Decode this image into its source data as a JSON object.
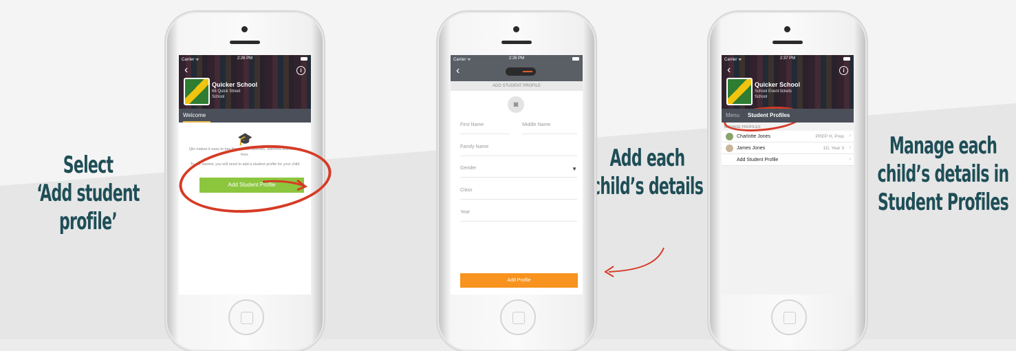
{
  "captions": {
    "step1_line1": "Select",
    "step1_line2": "‘Add student profile’",
    "step2_line1": "Add each",
    "step2_line2": "child’s details",
    "step3_line1": "Manage each",
    "step3_line2": "child’s details in",
    "step3_line3": "Student Profiles"
  },
  "colors": {
    "caption": "#1f4e57",
    "green_button": "#8cc63f",
    "orange_button": "#f7931e",
    "annotation_red": "#d63b25"
  },
  "screen1": {
    "carrier": "Carrier ᯤ",
    "time": "2:26 PM",
    "school_name": "Quicker School",
    "school_address": "66 Quick Street",
    "school_type": "School",
    "tab_welcome": "Welcome",
    "welcome_text": "Qkr makes it easy to pay for canteen lunches, uniforms and school fees.",
    "welcome_text2": "To get started, you will need to add a student profile for your child",
    "add_button": "Add Student Profile",
    "icons": [
      "back-icon",
      "info-icon",
      "graduation-cap-icon"
    ]
  },
  "screen2": {
    "carrier": "Carrier ᯤ",
    "time": "2:26 PM",
    "subheader": "ADD STUDENT PROFILE",
    "fields": {
      "first_name": "First Name",
      "middle_name": "Middle Name",
      "family_name": "Family Name",
      "gender": "Gender",
      "class": "Class",
      "year": "Year"
    },
    "submit_button": "Add Profile",
    "icons": [
      "back-icon",
      "camera-icon",
      "dropdown-arrow-icon"
    ]
  },
  "screen3": {
    "carrier": "Carrier ᯤ",
    "time": "2:37 PM",
    "school_name": "Quicker School",
    "school_sub": "School Event tickets",
    "school_type": "School",
    "tab_menu": "Menu",
    "tab_profiles": "Student Profiles",
    "manage_header": "MANAGE PROFILES",
    "profiles": [
      {
        "name": "Charlotte  Jones",
        "meta": "PREP H, Prep"
      },
      {
        "name": "James Jones",
        "meta": "1D, Year 3"
      }
    ],
    "add_profile_row": "Add Student Profile",
    "icons": [
      "back-icon",
      "info-icon",
      "chevron-right-icon"
    ]
  }
}
